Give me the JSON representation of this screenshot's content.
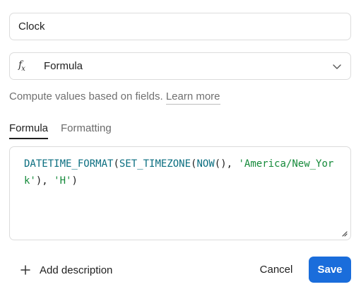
{
  "field": {
    "name_value": "Clock",
    "type_label": "Formula",
    "type_icon": "fx-icon"
  },
  "help": {
    "text": "Compute values based on fields.",
    "link": "Learn more"
  },
  "tabs": [
    {
      "label": "Formula",
      "active": true
    },
    {
      "label": "Formatting",
      "active": false
    }
  ],
  "formula": {
    "fn1": "DATETIME_FORMAT",
    "fn2": "SET_TIMEZONE",
    "fn3": "NOW",
    "arg_tz": "'America/New_York'",
    "arg_fmt": "'H'"
  },
  "footer": {
    "add_description": "Add description",
    "cancel": "Cancel",
    "save": "Save"
  },
  "colors": {
    "primary": "#1a6ddb",
    "function_token": "#0b6e80",
    "string_token": "#158a3a"
  }
}
